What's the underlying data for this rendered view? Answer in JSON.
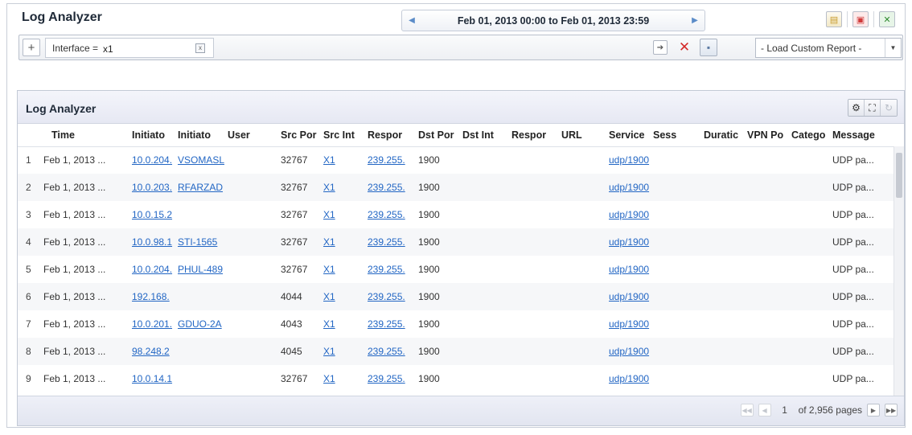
{
  "app": {
    "title": "Log Analyzer"
  },
  "date_range": {
    "text": "Feb 01, 2013 00:00 to Feb 01, 2013 23:59"
  },
  "toolbar_icons": [
    "report-icon",
    "pdf-icon",
    "excel-icon"
  ],
  "filter": {
    "add_label": "+",
    "label": "Interface =",
    "value": "x1",
    "remove": "x",
    "custom_report": "- Load Custom Report -"
  },
  "panel": {
    "title": "Log Analyzer",
    "columns": [
      "",
      "Time",
      "Initiato",
      "Initiato",
      "User",
      "Src Por",
      "Src Int",
      "Respor",
      "Dst Por",
      "Dst Int",
      "Respor",
      "URL",
      "Service",
      "Sess",
      "Duratic",
      "VPN Po",
      "Catego",
      "Message"
    ],
    "rows": [
      {
        "num": "1",
        "time": "Feb 1, 2013 ...",
        "initiator_ip": "10.0.204.",
        "initiator_name": "VSOMASL",
        "user": "",
        "src_port": "32767",
        "src_int": "X1",
        "responder": "239.255.",
        "dst_port": "1900",
        "dst_int": "",
        "responder2": "",
        "url": "",
        "service": "udp/1900",
        "sess": "",
        "duration": "",
        "vpn": "",
        "category": "",
        "message": "UDP pa..."
      },
      {
        "num": "2",
        "time": "Feb 1, 2013 ...",
        "initiator_ip": "10.0.203.",
        "initiator_name": "RFARZAD",
        "user": "",
        "src_port": "32767",
        "src_int": "X1",
        "responder": "239.255.",
        "dst_port": "1900",
        "dst_int": "",
        "responder2": "",
        "url": "",
        "service": "udp/1900",
        "sess": "",
        "duration": "",
        "vpn": "",
        "category": "",
        "message": "UDP pa..."
      },
      {
        "num": "3",
        "time": "Feb 1, 2013 ...",
        "initiator_ip": "10.0.15.2",
        "initiator_name": "",
        "user": "",
        "src_port": "32767",
        "src_int": "X1",
        "responder": "239.255.",
        "dst_port": "1900",
        "dst_int": "",
        "responder2": "",
        "url": "",
        "service": "udp/1900",
        "sess": "",
        "duration": "",
        "vpn": "",
        "category": "",
        "message": "UDP pa..."
      },
      {
        "num": "4",
        "time": "Feb 1, 2013 ...",
        "initiator_ip": "10.0.98.1",
        "initiator_name": "STI-1565",
        "user": "",
        "src_port": "32767",
        "src_int": "X1",
        "responder": "239.255.",
        "dst_port": "1900",
        "dst_int": "",
        "responder2": "",
        "url": "",
        "service": "udp/1900",
        "sess": "",
        "duration": "",
        "vpn": "",
        "category": "",
        "message": "UDP pa..."
      },
      {
        "num": "5",
        "time": "Feb 1, 2013 ...",
        "initiator_ip": "10.0.204.",
        "initiator_name": "PHUL-489",
        "user": "",
        "src_port": "32767",
        "src_int": "X1",
        "responder": "239.255.",
        "dst_port": "1900",
        "dst_int": "",
        "responder2": "",
        "url": "",
        "service": "udp/1900",
        "sess": "",
        "duration": "",
        "vpn": "",
        "category": "",
        "message": "UDP pa..."
      },
      {
        "num": "6",
        "time": "Feb 1, 2013 ...",
        "initiator_ip": "192.168.",
        "initiator_name": "",
        "user": "",
        "src_port": "4044",
        "src_int": "X1",
        "responder": "239.255.",
        "dst_port": "1900",
        "dst_int": "",
        "responder2": "",
        "url": "",
        "service": "udp/1900",
        "sess": "",
        "duration": "",
        "vpn": "",
        "category": "",
        "message": "UDP pa..."
      },
      {
        "num": "7",
        "time": "Feb 1, 2013 ...",
        "initiator_ip": "10.0.201.",
        "initiator_name": "GDUO-2A",
        "user": "",
        "src_port": "4043",
        "src_int": "X1",
        "responder": "239.255.",
        "dst_port": "1900",
        "dst_int": "",
        "responder2": "",
        "url": "",
        "service": "udp/1900",
        "sess": "",
        "duration": "",
        "vpn": "",
        "category": "",
        "message": "UDP pa..."
      },
      {
        "num": "8",
        "time": "Feb 1, 2013 ...",
        "initiator_ip": "98.248.2",
        "initiator_name": "",
        "user": "",
        "src_port": "4045",
        "src_int": "X1",
        "responder": "239.255.",
        "dst_port": "1900",
        "dst_int": "",
        "responder2": "",
        "url": "",
        "service": "udp/1900",
        "sess": "",
        "duration": "",
        "vpn": "",
        "category": "",
        "message": "UDP pa..."
      },
      {
        "num": "9",
        "time": "Feb 1, 2013 ...",
        "initiator_ip": "10.0.14.1",
        "initiator_name": "",
        "user": "",
        "src_port": "32767",
        "src_int": "X1",
        "responder": "239.255.",
        "dst_port": "1900",
        "dst_int": "",
        "responder2": "",
        "url": "",
        "service": "udp/1900",
        "sess": "",
        "duration": "",
        "vpn": "",
        "category": "",
        "message": "UDP pa..."
      }
    ]
  },
  "pager": {
    "page": "1",
    "total": "of 2,956 pages"
  },
  "colors": {
    "link": "#2266c4",
    "accent": "#5b8cc8",
    "clear": "#d42a2a"
  }
}
